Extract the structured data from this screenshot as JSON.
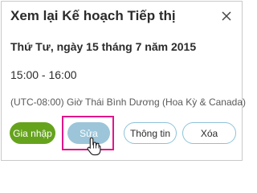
{
  "meeting": {
    "title": "Xem lại Kế hoạch Tiếp thị",
    "date": "Thứ Tư, ngày 15 tháng 7 năm 2015",
    "time": "15:00 - 16:00",
    "timezone": "(UTC-08:00) Giờ Thái Bình Dương (Hoa Kỳ & Canada)"
  },
  "actions": {
    "join_label": "Gia nhập",
    "edit_label": "Sửa",
    "info_label": "Thông tin",
    "delete_label": "Xóa"
  },
  "icons": {
    "close": "close-icon",
    "cursor": "hand-pointer-icon"
  },
  "colors": {
    "join_button": "#66a31d",
    "edit_button": "#9cc5d9",
    "button_border": "#8cc3d8",
    "highlight": "#e0168c"
  }
}
